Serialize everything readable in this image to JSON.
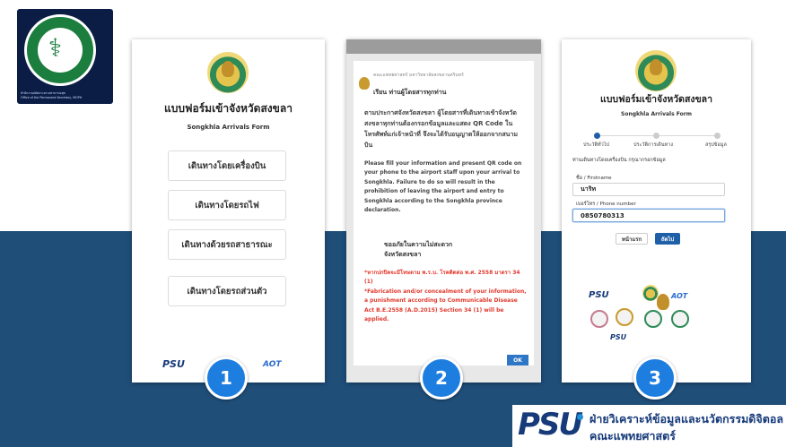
{
  "logo": {
    "name": "MINISTRY OF PUBLIC HEALTH",
    "caption_line1": "สำนักงานปลัดกระทรวงสาธารณสุข",
    "caption_line2": "Office of the Permanent Secretary, MOPH"
  },
  "phone1": {
    "form_title": "แบบฟอร์มเข้าจังหวัดสงขลา",
    "form_subtitle": "Songkhla Arrivals Form",
    "options": [
      "เดินทางโดยเครื่องบิน",
      "เดินทางโดยรถไฟ",
      "เดินทางด้วยรถสาธารณะ",
      "เดินทางโดยรถส่วนตัว"
    ],
    "psu_logo": "PSU",
    "aot_logo": "AOT",
    "step_number": "1"
  },
  "phone2": {
    "org": "คณะแพทยศาสตร์ มหาวิทยาลัยสงขลานครินทร์",
    "salutation": "เรียน ท่านผู้โดยสารทุกท่าน",
    "thai_notice": "ตามประกาศจังหวัดสงขลา ผู้โดยสารที่เดินทางเข้าจังหวัดสงขลาทุกท่านต้องกรอกข้อมูลและแสดง QR Code ในโทรศัพท์แก่เจ้าหน้าที่ จึงจะได้รับอนุญาตให้ออกจากสนามบิน",
    "english_notice": "Please fill your information and present QR code on your phone to the airport staff upon your arrival to Songkhla. Failure to do so will result in the prohibition of leaving the airport and entry to Songkhla according to the Songkhla province declaration.",
    "apology": "ขออภัยในความไม่สะดวก",
    "signature": "จังหวัดสงขลา",
    "warning_th": "*หากปกปิดจะมีโทษตาม พ.ร.บ. โรคติดต่อ พ.ศ. 2558 มาตรา 34 (1)",
    "warning_en": "*Fabrication and/or concealment of your information, a punishment according to Communicable Disease Act B.E.2558 (A.D.2015) Section 34 (1) will be applied.",
    "ok_label": "OK",
    "step_number": "2"
  },
  "phone3": {
    "form_title": "แบบฟอร์มเข้าจังหวัดสงขลา",
    "form_subtitle": "Songkhla Arrivals Form",
    "steps": [
      "ประวัติทั่วไป",
      "ประวัติการเดินทาง",
      "สรุปข้อมูล"
    ],
    "instruction": "ท่านเดินทางโดยเครื่องบิน กรุณากรอกข้อมูล",
    "firstname_label": "ชื่อ / Firstname",
    "firstname_value": "นาริท",
    "phone_label": "เบอร์โทร / Phone number",
    "phone_value": "0850780313",
    "back_label": "หน้าแรก",
    "next_label": "ถัดไป",
    "psu_logo": "PSU",
    "aot_logo": "AOT",
    "footer_psu": "PSU",
    "step_number": "3"
  },
  "banner": {
    "brand": "PSU",
    "line1": "ฝ่ายวิเคราะห์ข้อมูลและนวัตกรรมดิจิตอล",
    "line2": "คณะแพทยศาสตร์"
  },
  "colors": {
    "band": "#1f4e79",
    "step_badge": "#1e7ee0",
    "psu_navy": "#163a7a",
    "warning_red": "#e23a2e",
    "button_blue": "#1e5fa8"
  }
}
